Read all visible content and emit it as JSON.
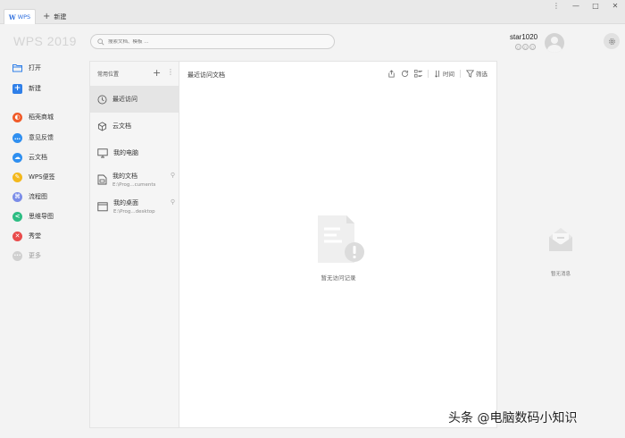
{
  "titlebar": {
    "tab_wps_logo": "W",
    "tab_wps_label": "WPS",
    "tab_new_label": "新建",
    "controls": {
      "menu": "⋮",
      "minimize": "—",
      "maximize": "□",
      "close": "✕"
    }
  },
  "header": {
    "brand": "WPS 2019",
    "search_placeholder": "搜索文档、模板 ...",
    "username": "star1020"
  },
  "nav": {
    "items": [
      {
        "label": "打开",
        "icon": "folder-open-icon",
        "color": "#2f7fe8"
      },
      {
        "label": "新建",
        "icon": "plus-square-icon",
        "color": "#2f7fe8"
      },
      {
        "label": "稻壳商城",
        "icon": "store-icon",
        "color": "#f05a28"
      },
      {
        "label": "意见反馈",
        "icon": "chat-icon",
        "color": "#2f8ff0"
      },
      {
        "label": "云文档",
        "icon": "cloud-icon",
        "color": "#2f8ff0"
      },
      {
        "label": "WPS便签",
        "icon": "pencil-icon",
        "color": "#f3b81d"
      },
      {
        "label": "流程图",
        "icon": "flowchart-icon",
        "color": "#7a8ce8"
      },
      {
        "label": "思维导图",
        "icon": "mindmap-icon",
        "color": "#2dbd83"
      },
      {
        "label": "秀堂",
        "icon": "xiutang-icon",
        "color": "#e94b4b"
      },
      {
        "label": "更多",
        "icon": "more-icon",
        "color": "#bbbbbb"
      }
    ]
  },
  "locations": {
    "header": "常用位置",
    "items": [
      {
        "label": "最近访问",
        "sub": ""
      },
      {
        "label": "云文档",
        "sub": ""
      },
      {
        "label": "我的电脑",
        "sub": ""
      },
      {
        "label": "我的文档",
        "sub": "E:\\Prog...cuments"
      },
      {
        "label": "我的桌面",
        "sub": "E:\\Prog...desktop"
      }
    ]
  },
  "main": {
    "title": "最近访问文档",
    "sort_label": "时间",
    "filter_label": "筛选",
    "empty_text": "暂无访问记录"
  },
  "right": {
    "empty_text": "暂无消息"
  },
  "watermark": "头条 @电脑数码小知识"
}
